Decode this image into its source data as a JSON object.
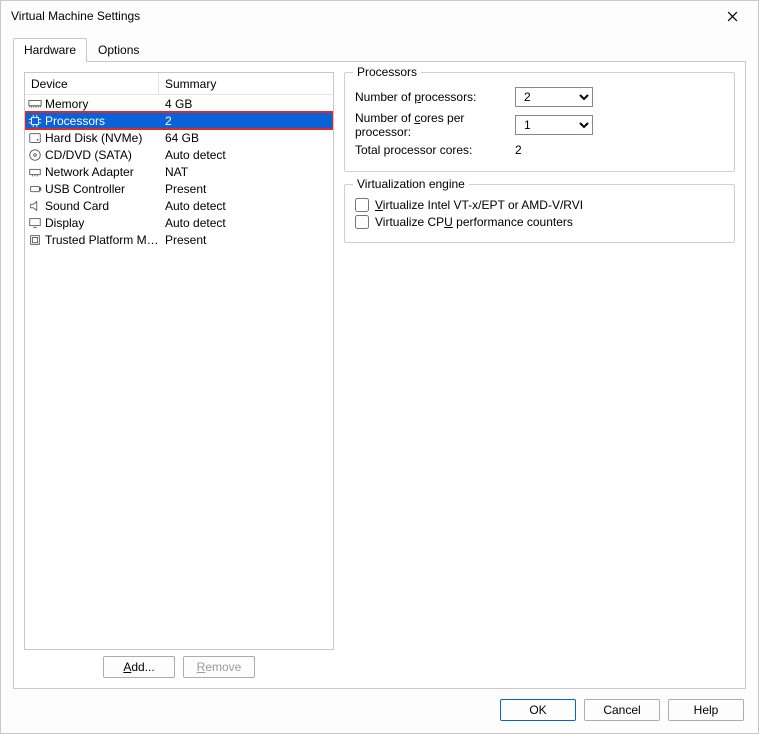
{
  "window": {
    "title": "Virtual Machine Settings"
  },
  "tabs": {
    "hardware": "Hardware",
    "options": "Options"
  },
  "list": {
    "header": {
      "device": "Device",
      "summary": "Summary"
    },
    "items": [
      {
        "icon": "memory",
        "name": "Memory",
        "summary": "4 GB",
        "selected": false
      },
      {
        "icon": "cpu",
        "name": "Processors",
        "summary": "2",
        "selected": true
      },
      {
        "icon": "disk",
        "name": "Hard Disk (NVMe)",
        "summary": "64 GB",
        "selected": false
      },
      {
        "icon": "cd",
        "name": "CD/DVD (SATA)",
        "summary": "Auto detect",
        "selected": false
      },
      {
        "icon": "net",
        "name": "Network Adapter",
        "summary": "NAT",
        "selected": false
      },
      {
        "icon": "usb",
        "name": "USB Controller",
        "summary": "Present",
        "selected": false
      },
      {
        "icon": "sound",
        "name": "Sound Card",
        "summary": "Auto detect",
        "selected": false
      },
      {
        "icon": "display",
        "name": "Display",
        "summary": "Auto detect",
        "selected": false
      },
      {
        "icon": "tpm",
        "name": "Trusted Platform Mo…",
        "summary": "Present",
        "selected": false
      }
    ]
  },
  "buttons": {
    "add": "Add...",
    "remove": "Remove"
  },
  "procGroup": {
    "title": "Processors",
    "numProcLabel": "Number of processors:",
    "numProcValue": "2",
    "coresLabel": "Number of cores per processor:",
    "coresValue": "1",
    "totalLabel": "Total processor cores:",
    "totalValue": "2"
  },
  "virtGroup": {
    "title": "Virtualization engine",
    "vt": "Virtualize Intel VT-x/EPT or AMD-V/RVI",
    "perf": "Virtualize CPU performance counters"
  },
  "footer": {
    "ok": "OK",
    "cancel": "Cancel",
    "help": "Help"
  }
}
